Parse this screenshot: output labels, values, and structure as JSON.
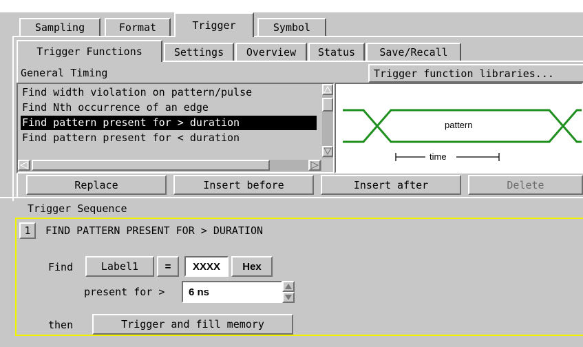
{
  "main_tabs": [
    "Sampling",
    "Format",
    "Trigger",
    "Symbol"
  ],
  "sub_tabs": [
    "Trigger Functions",
    "Settings",
    "Overview",
    "Status",
    "Save/Recall"
  ],
  "category_label": "General Timing",
  "libraries_button": "Trigger function libraries...",
  "functions": [
    "Find width violation on pattern/pulse",
    "Find Nth occurrence of an edge",
    "Find pattern present for > duration",
    "Find pattern present for < duration"
  ],
  "selected_function_index": 2,
  "diagram": {
    "pattern_label": "pattern",
    "time_label": "time",
    "signal_color": "#1f8f1f"
  },
  "action_buttons": {
    "replace": "Replace",
    "insert_before": "Insert before",
    "insert_after": "Insert after",
    "delete": "Delete"
  },
  "sequence": {
    "title": "Trigger Sequence",
    "step_number": "1",
    "step_title": "FIND PATTERN PRESENT FOR > DURATION",
    "find_label": "Find",
    "label_button": "Label1",
    "operator": "=",
    "pattern_value": "XXXX",
    "base": "Hex",
    "present_label": "present for >",
    "duration_value": "6 ns",
    "then_label": "then",
    "action": "Trigger and fill memory"
  }
}
